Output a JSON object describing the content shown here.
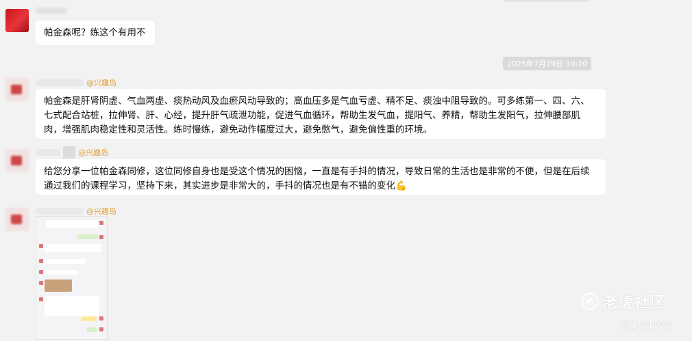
{
  "messages": [
    {
      "text": "帕金森呢？练这个有用不"
    },
    {
      "sender": "@兴趣岛",
      "text": "帕金森是肝肾阴虚、气血两虚、痰热动风及血瘀风动导致的；高血压多是气血亏虚、精不足、痰浊中阻导致的。可多练第一、四、六、七式配合站桩，拉伸肾、肝、心经，提升肝气疏泄功能，促进气血循环，帮助生发气血，提阳气、养精，帮助生发阳气，拉伸腰部肌肉，增强肌肉稳定性和灵活性。练时慢练，避免动作幅度过大，避免憋气，避免偏性重的环境。"
    },
    {
      "sender": "@兴趣岛",
      "text": "给您分享一位帕金森同修，这位同修自身也是受这个情况的困恼，一直是有手抖的情况，导致日常的生活也是非常的不便，但是在后续通过我们的课程学习，坚持下来，其实进步是非常大的，手抖的情况也是有不错的变化",
      "emoji": "💪"
    },
    {
      "sender": "@兴趣岛"
    }
  ],
  "timestamp": "2025年7月29日 10:20",
  "watermark": {
    "logo_text": "老虎社区",
    "credit": "@DoNews"
  },
  "colors": {
    "background": "#f2f2f2",
    "bubble": "#ffffff",
    "sender": "#e0a03a"
  }
}
